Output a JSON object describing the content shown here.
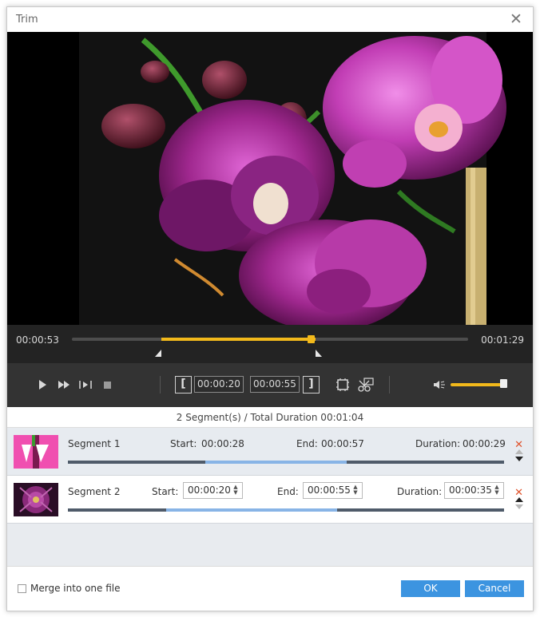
{
  "window": {
    "title": "Trim",
    "close_glyph": "✕"
  },
  "timeline": {
    "current_time": "00:00:53",
    "total_time": "00:01:29",
    "selection_start_fraction": 0.2253,
    "selection_end_fraction": 0.6152,
    "playhead_fraction": 0.6027
  },
  "controls": {
    "start_time": "00:00:20",
    "end_time": "00:00:55",
    "volume_fraction": 0.92,
    "set_start_glyph": "[",
    "set_end_glyph": "]"
  },
  "summary": {
    "text": "2 Segment(s) / Total Duration 00:01:04"
  },
  "segments": [
    {
      "name": "Segment 1",
      "start_label": "Start:",
      "start": "00:00:28",
      "end_label": "End:",
      "end": "00:00:57",
      "duration_label": "Duration:",
      "duration": "00:00:29",
      "sel_start_fraction": 0.315,
      "sel_end_fraction": 0.64
    },
    {
      "name": "Segment 2",
      "start_label": "Start:",
      "start": "00:00:20",
      "end_label": "End:",
      "end": "00:00:55",
      "duration_label": "Duration:",
      "duration": "00:00:35",
      "sel_start_fraction": 0.225,
      "sel_end_fraction": 0.617
    }
  ],
  "footer": {
    "merge_label": "Merge into one file",
    "ok_label": "OK",
    "cancel_label": "Cancel"
  },
  "colors": {
    "accent": "#f2b91b",
    "button": "#3c94e0",
    "segment_bar": "#4f5b6a",
    "segment_sel": "#88b4e6",
    "delete": "#e0522b"
  },
  "icons": {
    "play": "play-icon",
    "fast_forward": "fast-forward-icon",
    "frame": "frame-step-icon",
    "stop": "stop-icon",
    "crop": "crop-icon",
    "cut": "scissors-icon",
    "volume": "volume-icon",
    "delete": "delete-icon"
  }
}
